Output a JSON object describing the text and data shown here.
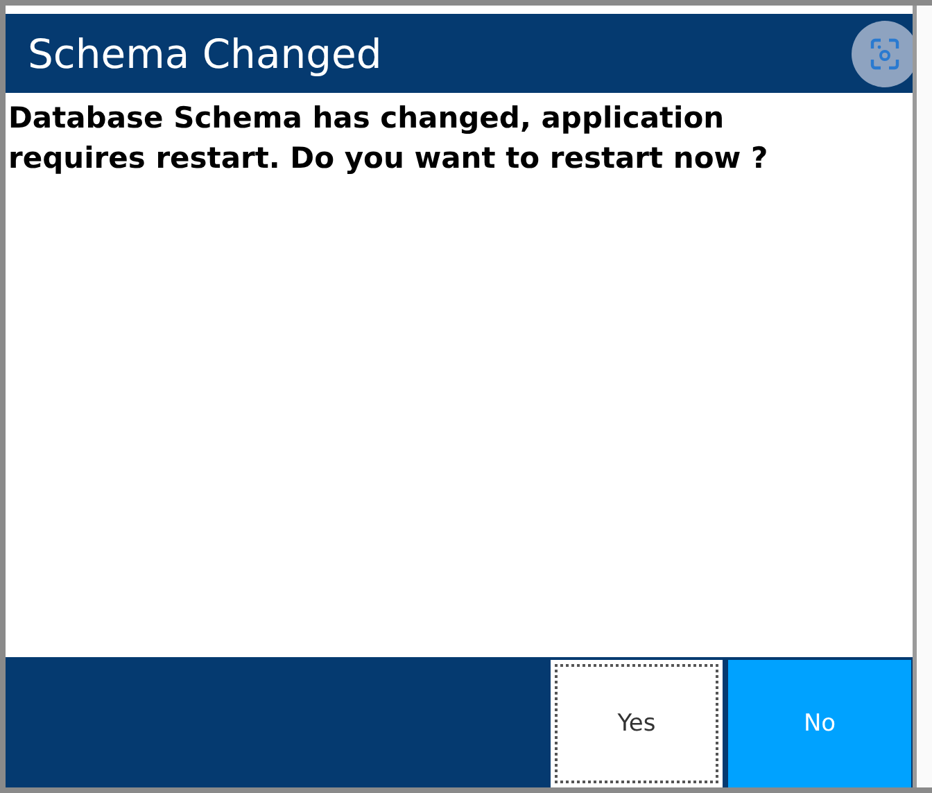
{
  "dialog": {
    "title": "Schema Changed",
    "message": "Database Schema has changed, application requires restart. Do you want to restart now ?",
    "buttons": [
      {
        "label": "Yes",
        "kind": "secondary",
        "focused": true
      },
      {
        "label": "No",
        "kind": "primary",
        "focused": false
      }
    ]
  }
}
